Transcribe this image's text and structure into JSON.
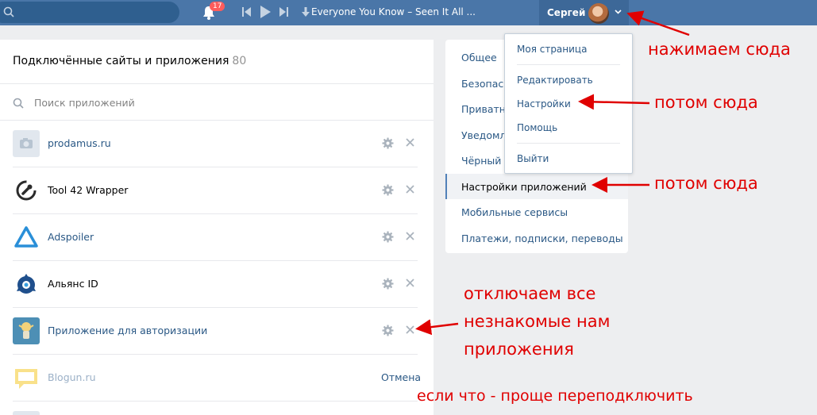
{
  "topbar": {
    "notifications_count": "17",
    "track_title": "Everyone You Know – Seen It All ...",
    "user_name": "Сергей"
  },
  "apps_panel": {
    "title": "Подключённые сайты и приложения",
    "count": "80",
    "search_placeholder": "Поиск приложений",
    "cancel_label": "Отмена",
    "apps": [
      {
        "name": "prodamus.ru",
        "icon": "camera-icon"
      },
      {
        "name": "Tool 42 Wrapper",
        "icon": "wrench-icon"
      },
      {
        "name": "Adspoiler",
        "icon": "triangle-logo-icon"
      },
      {
        "name": "Альянс ID",
        "icon": "alliance-logo-icon"
      },
      {
        "name": "Приложение для авторизации",
        "icon": "mascot-icon"
      },
      {
        "name": "Blogun.ru",
        "icon": "speech-bubble-icon"
      }
    ]
  },
  "settings_menu": {
    "items": [
      "Общее",
      "Безопасность",
      "Приватность",
      "Уведомления",
      "Чёрный список",
      "Настройки приложений",
      "Мобильные сервисы",
      "Платежи, подписки, переводы"
    ]
  },
  "dropdown": {
    "my_page": "Моя страница",
    "edit": "Редактировать",
    "settings": "Настройки",
    "help": "Помощь",
    "logout": "Выйти"
  },
  "annotations": {
    "click_here": "нажимаем сюда",
    "then_here_1": "потом сюда",
    "then_here_2": "потом сюда",
    "disable_line1": "отключаем все",
    "disable_line2": "незнакомые нам",
    "disable_line3": "приложения",
    "reconnect": "если что - проще переподключить"
  },
  "colors": {
    "header_blue": "#4a76a8",
    "link_blue": "#2a5885",
    "annotation_red": "#e00000"
  }
}
